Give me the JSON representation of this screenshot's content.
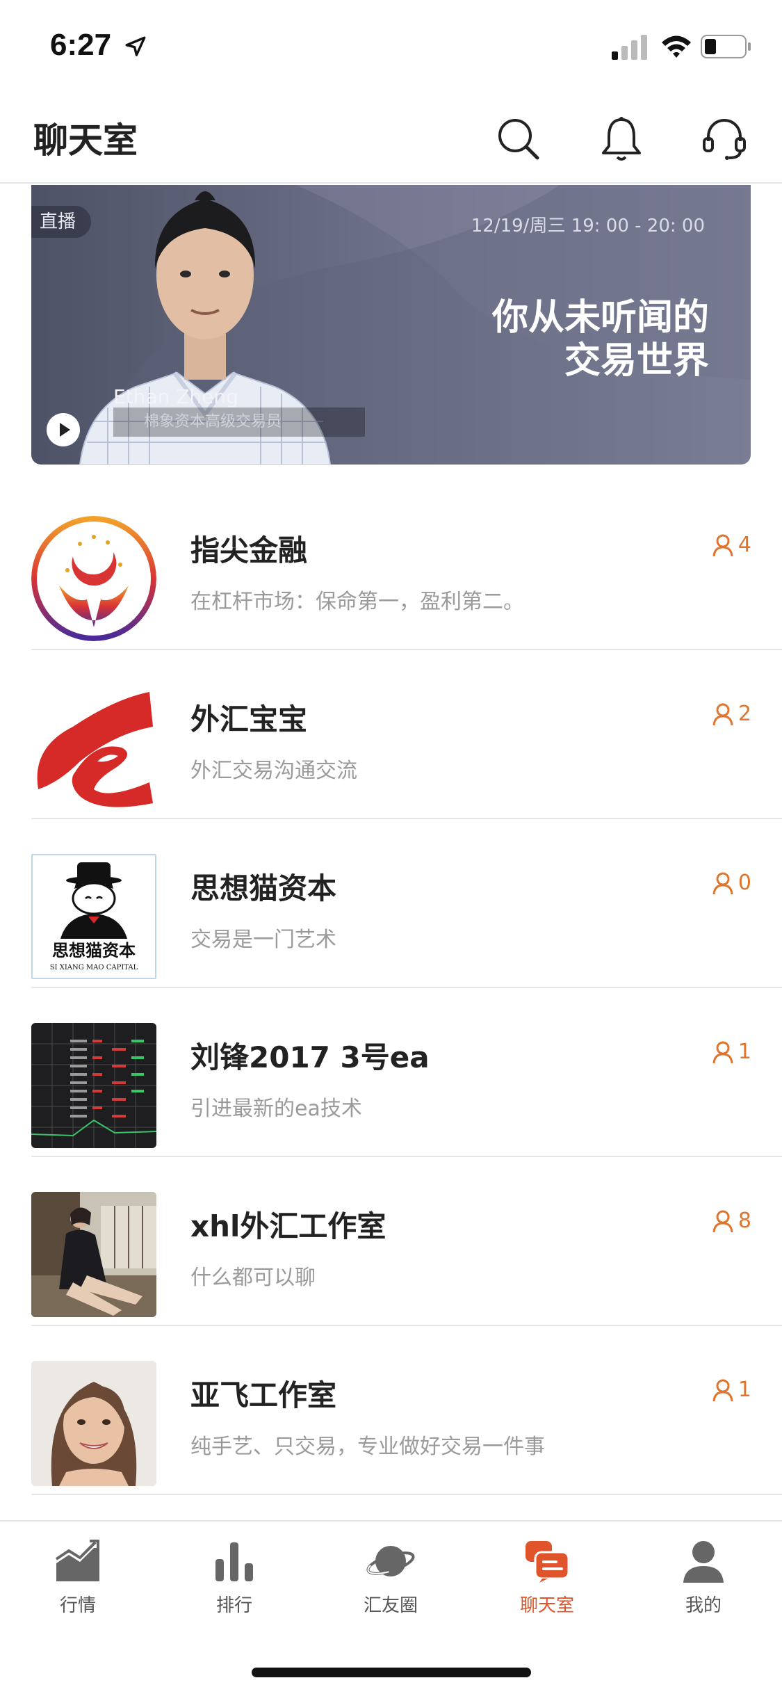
{
  "status_bar": {
    "time": "6:27"
  },
  "nav": {
    "title": "聊天室",
    "icons": [
      "search-icon",
      "bell-icon",
      "customer-service-icon"
    ]
  },
  "banner": {
    "live_badge": "直播",
    "schedule": "12/19/周三 19: 00 - 20: 00",
    "headline_line1": "你从未听闻的",
    "headline_line2": "交易世界",
    "presenter_name": "Ethan Zheng",
    "presenter_title": "棉象资本高级交易员"
  },
  "rooms": [
    {
      "name": "指尖金融",
      "desc": "在杠杆市场：保命第一，盈利第二。",
      "members": "4"
    },
    {
      "name": "外汇宝宝",
      "desc": "外汇交易沟通交流",
      "members": "2"
    },
    {
      "name": "思想猫资本",
      "desc": "交易是一门艺术",
      "members": "0",
      "avatar_text": "思想猫资本",
      "avatar_subtext": "SI XIANG MAO CAPITAL"
    },
    {
      "name": "刘锋2017 3号ea",
      "desc": "引进最新的ea技术",
      "members": "1"
    },
    {
      "name": "xhl外汇工作室",
      "desc": "什么都可以聊",
      "members": "8"
    },
    {
      "name": "亚飞工作室",
      "desc": "纯手艺、只交易，专业做好交易一件事",
      "members": "1"
    }
  ],
  "tabs": [
    {
      "label": "行情",
      "icon": "market-chart-icon"
    },
    {
      "label": "排行",
      "icon": "ranking-bars-icon"
    },
    {
      "label": "汇友圈",
      "icon": "planet-icon"
    },
    {
      "label": "聊天室",
      "icon": "chat-icon",
      "active": true
    },
    {
      "label": "我的",
      "icon": "profile-icon"
    }
  ],
  "colors": {
    "accent": "#e0742c",
    "active_tab": "#e0542c",
    "banner": "#6a6e85"
  }
}
